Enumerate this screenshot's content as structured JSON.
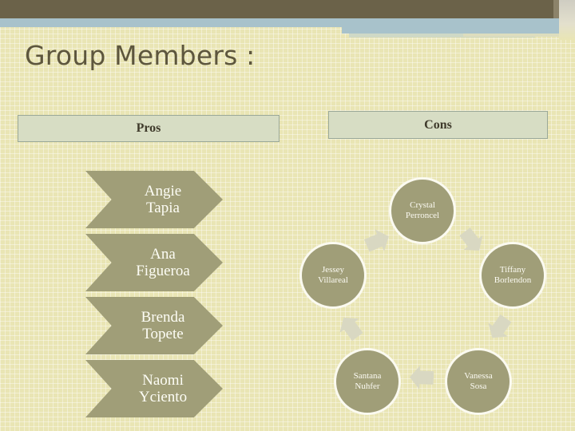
{
  "slide": {
    "title": "Group Members :",
    "background_color": "#e9e5b4",
    "accent_color": "#a09e78",
    "top_bar_color": "#6b6249",
    "top_accent_color": "#a8c2cb"
  },
  "pros": {
    "header_label": "Pros",
    "items": [
      {
        "line1": "Angie",
        "line2": "Tapia"
      },
      {
        "line1": "Ana",
        "line2": "Figueroa"
      },
      {
        "line1": "Brenda",
        "line2": "Topete"
      },
      {
        "line1": "Naomi",
        "line2": "Yciento"
      }
    ]
  },
  "cons": {
    "header_label": "Cons",
    "items": [
      {
        "line1": "Crystal",
        "line2": "Perroncel"
      },
      {
        "line1": "Tiffany",
        "line2": "Borlendon"
      },
      {
        "line1": "Vanessa",
        "line2": "Sosa"
      },
      {
        "line1": "Santana",
        "line2": "Nuhfer"
      },
      {
        "line1": "Jessey",
        "line2": "Villareal"
      }
    ]
  }
}
